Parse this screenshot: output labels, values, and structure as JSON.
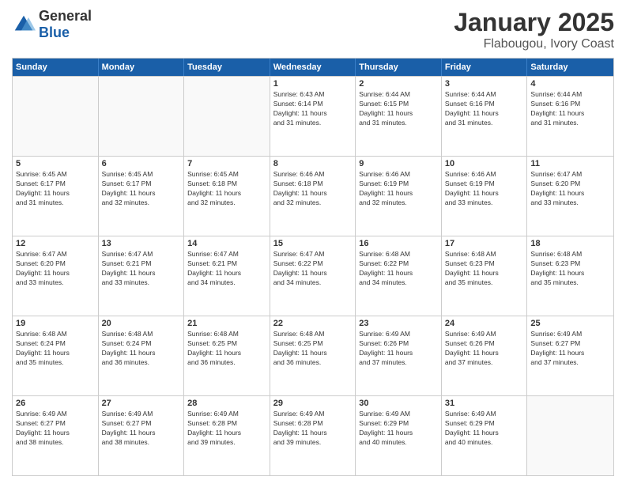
{
  "header": {
    "logo_general": "General",
    "logo_blue": "Blue",
    "title": "January 2025",
    "subtitle": "Flabougou, Ivory Coast"
  },
  "days_of_week": [
    "Sunday",
    "Monday",
    "Tuesday",
    "Wednesday",
    "Thursday",
    "Friday",
    "Saturday"
  ],
  "weeks": [
    [
      {
        "day": "",
        "info": ""
      },
      {
        "day": "",
        "info": ""
      },
      {
        "day": "",
        "info": ""
      },
      {
        "day": "1",
        "info": "Sunrise: 6:43 AM\nSunset: 6:14 PM\nDaylight: 11 hours\nand 31 minutes."
      },
      {
        "day": "2",
        "info": "Sunrise: 6:44 AM\nSunset: 6:15 PM\nDaylight: 11 hours\nand 31 minutes."
      },
      {
        "day": "3",
        "info": "Sunrise: 6:44 AM\nSunset: 6:16 PM\nDaylight: 11 hours\nand 31 minutes."
      },
      {
        "day": "4",
        "info": "Sunrise: 6:44 AM\nSunset: 6:16 PM\nDaylight: 11 hours\nand 31 minutes."
      }
    ],
    [
      {
        "day": "5",
        "info": "Sunrise: 6:45 AM\nSunset: 6:17 PM\nDaylight: 11 hours\nand 31 minutes."
      },
      {
        "day": "6",
        "info": "Sunrise: 6:45 AM\nSunset: 6:17 PM\nDaylight: 11 hours\nand 32 minutes."
      },
      {
        "day": "7",
        "info": "Sunrise: 6:45 AM\nSunset: 6:18 PM\nDaylight: 11 hours\nand 32 minutes."
      },
      {
        "day": "8",
        "info": "Sunrise: 6:46 AM\nSunset: 6:18 PM\nDaylight: 11 hours\nand 32 minutes."
      },
      {
        "day": "9",
        "info": "Sunrise: 6:46 AM\nSunset: 6:19 PM\nDaylight: 11 hours\nand 32 minutes."
      },
      {
        "day": "10",
        "info": "Sunrise: 6:46 AM\nSunset: 6:19 PM\nDaylight: 11 hours\nand 33 minutes."
      },
      {
        "day": "11",
        "info": "Sunrise: 6:47 AM\nSunset: 6:20 PM\nDaylight: 11 hours\nand 33 minutes."
      }
    ],
    [
      {
        "day": "12",
        "info": "Sunrise: 6:47 AM\nSunset: 6:20 PM\nDaylight: 11 hours\nand 33 minutes."
      },
      {
        "day": "13",
        "info": "Sunrise: 6:47 AM\nSunset: 6:21 PM\nDaylight: 11 hours\nand 33 minutes."
      },
      {
        "day": "14",
        "info": "Sunrise: 6:47 AM\nSunset: 6:21 PM\nDaylight: 11 hours\nand 34 minutes."
      },
      {
        "day": "15",
        "info": "Sunrise: 6:47 AM\nSunset: 6:22 PM\nDaylight: 11 hours\nand 34 minutes."
      },
      {
        "day": "16",
        "info": "Sunrise: 6:48 AM\nSunset: 6:22 PM\nDaylight: 11 hours\nand 34 minutes."
      },
      {
        "day": "17",
        "info": "Sunrise: 6:48 AM\nSunset: 6:23 PM\nDaylight: 11 hours\nand 35 minutes."
      },
      {
        "day": "18",
        "info": "Sunrise: 6:48 AM\nSunset: 6:23 PM\nDaylight: 11 hours\nand 35 minutes."
      }
    ],
    [
      {
        "day": "19",
        "info": "Sunrise: 6:48 AM\nSunset: 6:24 PM\nDaylight: 11 hours\nand 35 minutes."
      },
      {
        "day": "20",
        "info": "Sunrise: 6:48 AM\nSunset: 6:24 PM\nDaylight: 11 hours\nand 36 minutes."
      },
      {
        "day": "21",
        "info": "Sunrise: 6:48 AM\nSunset: 6:25 PM\nDaylight: 11 hours\nand 36 minutes."
      },
      {
        "day": "22",
        "info": "Sunrise: 6:48 AM\nSunset: 6:25 PM\nDaylight: 11 hours\nand 36 minutes."
      },
      {
        "day": "23",
        "info": "Sunrise: 6:49 AM\nSunset: 6:26 PM\nDaylight: 11 hours\nand 37 minutes."
      },
      {
        "day": "24",
        "info": "Sunrise: 6:49 AM\nSunset: 6:26 PM\nDaylight: 11 hours\nand 37 minutes."
      },
      {
        "day": "25",
        "info": "Sunrise: 6:49 AM\nSunset: 6:27 PM\nDaylight: 11 hours\nand 37 minutes."
      }
    ],
    [
      {
        "day": "26",
        "info": "Sunrise: 6:49 AM\nSunset: 6:27 PM\nDaylight: 11 hours\nand 38 minutes."
      },
      {
        "day": "27",
        "info": "Sunrise: 6:49 AM\nSunset: 6:27 PM\nDaylight: 11 hours\nand 38 minutes."
      },
      {
        "day": "28",
        "info": "Sunrise: 6:49 AM\nSunset: 6:28 PM\nDaylight: 11 hours\nand 39 minutes."
      },
      {
        "day": "29",
        "info": "Sunrise: 6:49 AM\nSunset: 6:28 PM\nDaylight: 11 hours\nand 39 minutes."
      },
      {
        "day": "30",
        "info": "Sunrise: 6:49 AM\nSunset: 6:29 PM\nDaylight: 11 hours\nand 40 minutes."
      },
      {
        "day": "31",
        "info": "Sunrise: 6:49 AM\nSunset: 6:29 PM\nDaylight: 11 hours\nand 40 minutes."
      },
      {
        "day": "",
        "info": ""
      }
    ]
  ]
}
